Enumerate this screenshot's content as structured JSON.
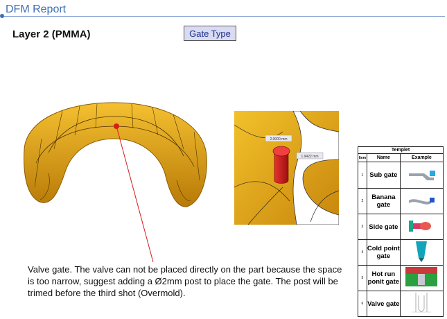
{
  "header": {
    "title": "DFM Report"
  },
  "layer_title": "Layer 2 (PMMA)",
  "gate_type_button": "Gate Type",
  "closeup": {
    "dim1": "2.0000 mm",
    "dim2": "1.9422 mm"
  },
  "note": "Valve gate. The valve can not be placed directly on the part because the space is too narrow, suggest adding a Ø2mm post to place the gate. The post will be trimed before the third shot (Overmold).",
  "templet": {
    "caption": "Templet",
    "headers": {
      "item": "Item",
      "name": "Name",
      "example": "Example"
    },
    "rows": [
      {
        "item": "1",
        "name": "Sub gate",
        "example_icon": "sub-gate-icon"
      },
      {
        "item": "2",
        "name": "Banana gate",
        "example_icon": "banana-gate-icon"
      },
      {
        "item": "3",
        "name": "Side gate",
        "example_icon": "side-gate-icon"
      },
      {
        "item": "4",
        "name": "Cold point gate",
        "example_icon": "cold-point-gate-icon"
      },
      {
        "item": "5",
        "name": "Hot run ponit gate",
        "example_icon": "hot-runner-gate-icon"
      },
      {
        "item": "6",
        "name": "Valve gate",
        "example_icon": "valve-gate-icon"
      }
    ]
  },
  "colors": {
    "header_blue": "#3f6fb5",
    "part_orange": "#e9a91a",
    "gate_red": "#d81b1b"
  }
}
